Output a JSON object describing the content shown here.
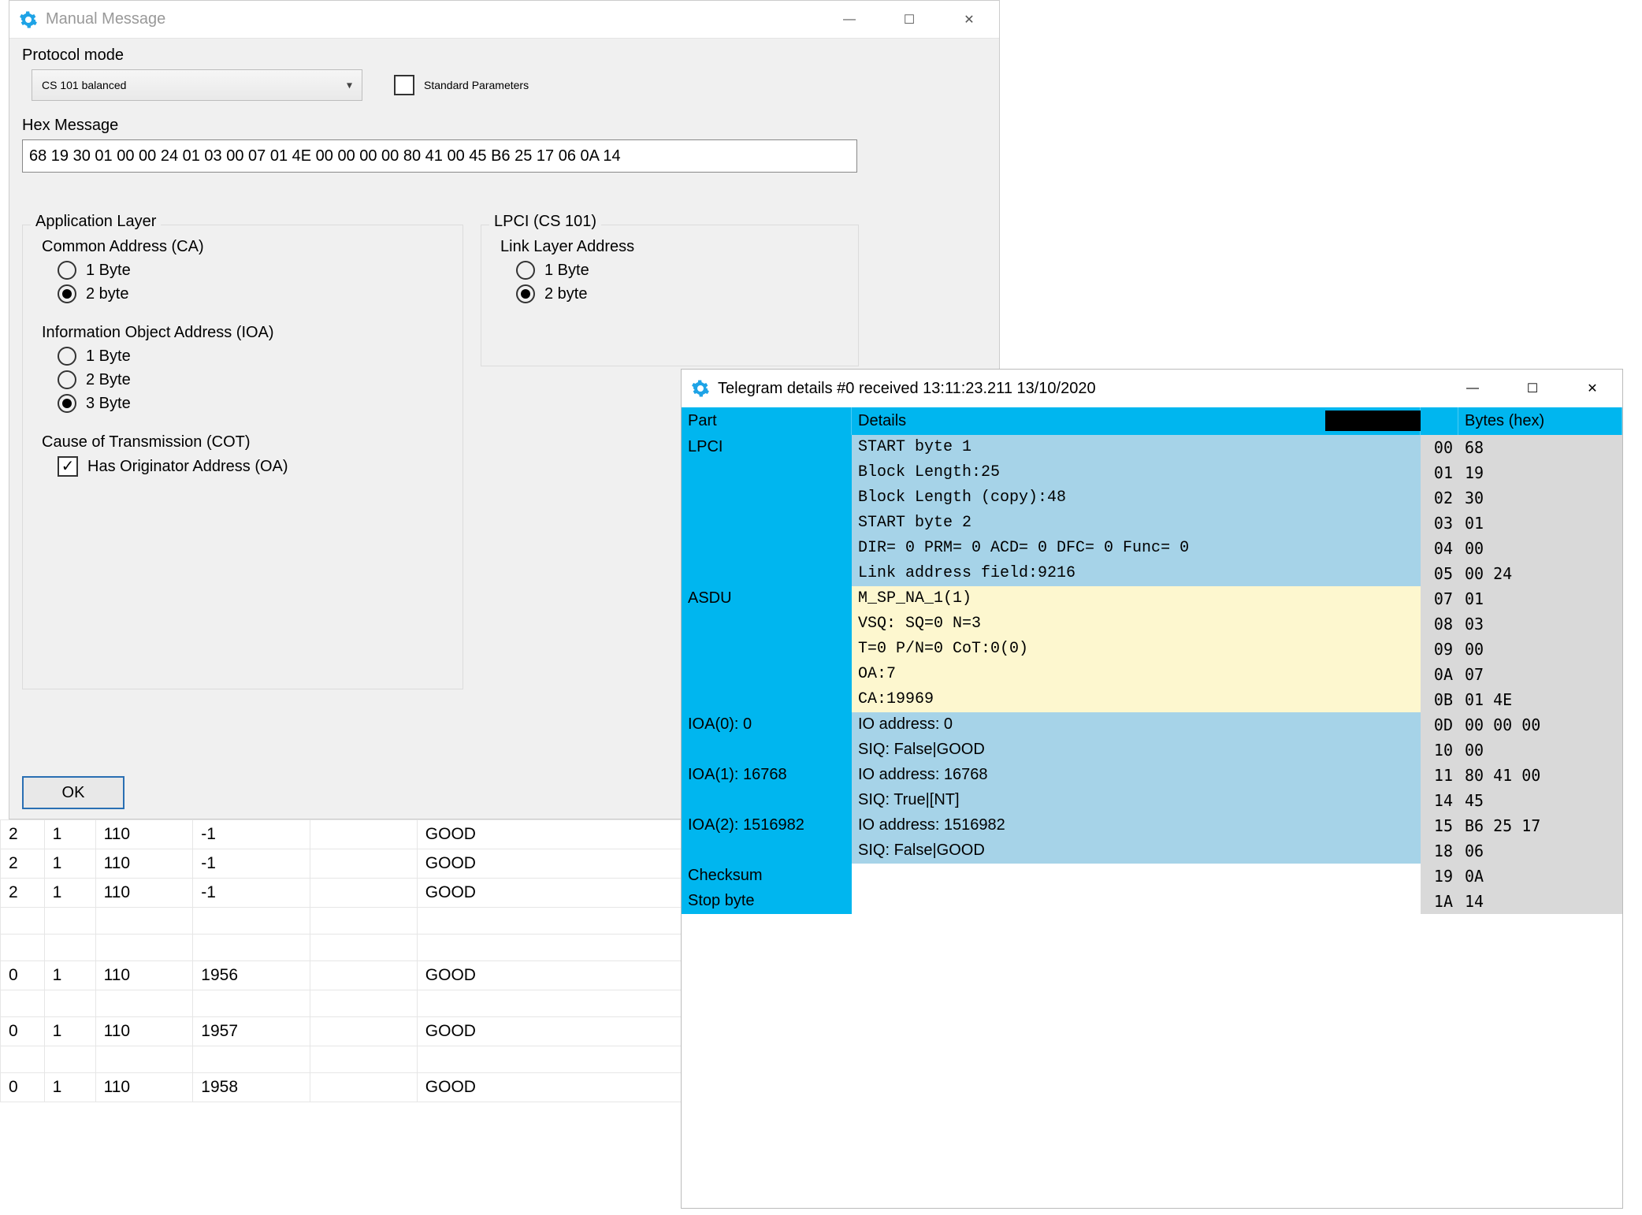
{
  "manual_message": {
    "title": "Manual Message",
    "protocol_mode_label": "Protocol mode",
    "protocol_mode_value": "CS 101 balanced",
    "standard_parameters_label": "Standard Parameters",
    "standard_parameters_checked": false,
    "hex_message_label": "Hex Message",
    "hex_message_value": "68 19 30 01 00 00 24 01 03 00 07 01 4E 00 00 00 00 80 41 00 45 B6 25 17 06 0A 14",
    "app_layer": {
      "legend": "Application Layer",
      "ca": {
        "label": "Common Address (CA)",
        "options": [
          "1 Byte",
          "2 byte"
        ],
        "selected": "2 byte"
      },
      "ioa": {
        "label": "Information Object Address (IOA)",
        "options": [
          "1 Byte",
          "2 Byte",
          "3 Byte"
        ],
        "selected": "3 Byte"
      },
      "cot": {
        "label": "Cause of Transmission (COT)",
        "has_oa_label": "Has Originator Address (OA)",
        "has_oa_checked": true
      }
    },
    "lpci": {
      "legend": "LPCI (CS 101)",
      "lla": {
        "label": "Link Layer Address",
        "options": [
          "1 Byte",
          "2 byte"
        ],
        "selected": "2 byte"
      }
    },
    "ok_label": "OK"
  },
  "background_rows": [
    {
      "c1": "2",
      "c2": "1",
      "c3": "110",
      "c4": "-1",
      "c5": "",
      "c6": "GOOD"
    },
    {
      "c1": "2",
      "c2": "1",
      "c3": "110",
      "c4": "-1",
      "c5": "",
      "c6": "GOOD"
    },
    {
      "c1": "2",
      "c2": "1",
      "c3": "110",
      "c4": "-1",
      "c5": "",
      "c6": "GOOD"
    },
    {
      "c1": "",
      "c2": "",
      "c3": "",
      "c4": "",
      "c5": "",
      "c6": ""
    },
    {
      "c1": "",
      "c2": "",
      "c3": "",
      "c4": "",
      "c5": "",
      "c6": ""
    },
    {
      "c1": "0",
      "c2": "1",
      "c3": "110",
      "c4": "1956",
      "c5": "",
      "c6": "GOOD"
    },
    {
      "c1": "",
      "c2": "",
      "c3": "",
      "c4": "",
      "c5": "",
      "c6": ""
    },
    {
      "c1": "0",
      "c2": "1",
      "c3": "110",
      "c4": "1957",
      "c5": "",
      "c6": "GOOD"
    },
    {
      "c1": "",
      "c2": "",
      "c3": "",
      "c4": "",
      "c5": "",
      "c6": ""
    },
    {
      "c1": "0",
      "c2": "1",
      "c3": "110",
      "c4": "1958",
      "c5": "",
      "c6": "GOOD"
    }
  ],
  "telegram_details": {
    "title": "Telegram details #0 received 13:11:23.211 13/10/2020",
    "columns": {
      "part": "Part",
      "details": "Details",
      "bytes": "Bytes (hex)"
    },
    "rows": [
      {
        "group": "lpci",
        "part": "LPCI",
        "details": "START byte 1",
        "idx": "00",
        "hex": "68"
      },
      {
        "group": "lpci",
        "part": "",
        "details": "Block Length:25",
        "idx": "01",
        "hex": "19"
      },
      {
        "group": "lpci",
        "part": "",
        "details": "Block Length (copy):48",
        "idx": "02",
        "hex": "30"
      },
      {
        "group": "lpci",
        "part": "",
        "details": "START byte 2",
        "idx": "03",
        "hex": "01"
      },
      {
        "group": "lpci",
        "part": "",
        "details": "DIR= 0 PRM= 0 ACD= 0 DFC= 0 Func= 0",
        "idx": "04",
        "hex": "00"
      },
      {
        "group": "lpci",
        "part": "",
        "details": "Link address field:9216",
        "idx": "05",
        "hex": "00 24"
      },
      {
        "group": "asdu",
        "part": "ASDU",
        "details": "M_SP_NA_1(1)",
        "idx": "07",
        "hex": "01"
      },
      {
        "group": "asdu",
        "part": "",
        "details": "VSQ: SQ=0 N=3",
        "idx": "08",
        "hex": "03"
      },
      {
        "group": "asdu",
        "part": "",
        "details": "T=0 P/N=0 CoT:0(0)",
        "idx": "09",
        "hex": "00"
      },
      {
        "group": "asdu",
        "part": "",
        "details": "OA:7",
        "idx": "0A",
        "hex": "07"
      },
      {
        "group": "asdu",
        "part": "",
        "details": "CA:19969",
        "idx": "0B",
        "hex": "01 4E"
      },
      {
        "group": "ioa",
        "part": "IOA(0): 0",
        "details": "IO address: 0",
        "idx": "0D",
        "hex": "00 00 00"
      },
      {
        "group": "ioa",
        "part": "",
        "details": "SIQ: False|GOOD",
        "idx": "10",
        "hex": "00"
      },
      {
        "group": "ioa",
        "part": "IOA(1): 16768",
        "details": "IO address: 16768",
        "idx": "11",
        "hex": "80 41 00"
      },
      {
        "group": "ioa",
        "part": "",
        "details": "SIQ: True|[NT]",
        "idx": "14",
        "hex": "45"
      },
      {
        "group": "ioa",
        "part": "IOA(2): 1516982",
        "details": "IO address: 1516982",
        "idx": "15",
        "hex": "B6 25 17"
      },
      {
        "group": "ioa",
        "part": "",
        "details": "SIQ: False|GOOD",
        "idx": "18",
        "hex": "06"
      },
      {
        "group": "tail",
        "part": "Checksum",
        "details": "",
        "idx": "19",
        "hex": "0A"
      },
      {
        "group": "tail",
        "part": "Stop byte",
        "details": "",
        "idx": "1A",
        "hex": "14"
      }
    ]
  }
}
